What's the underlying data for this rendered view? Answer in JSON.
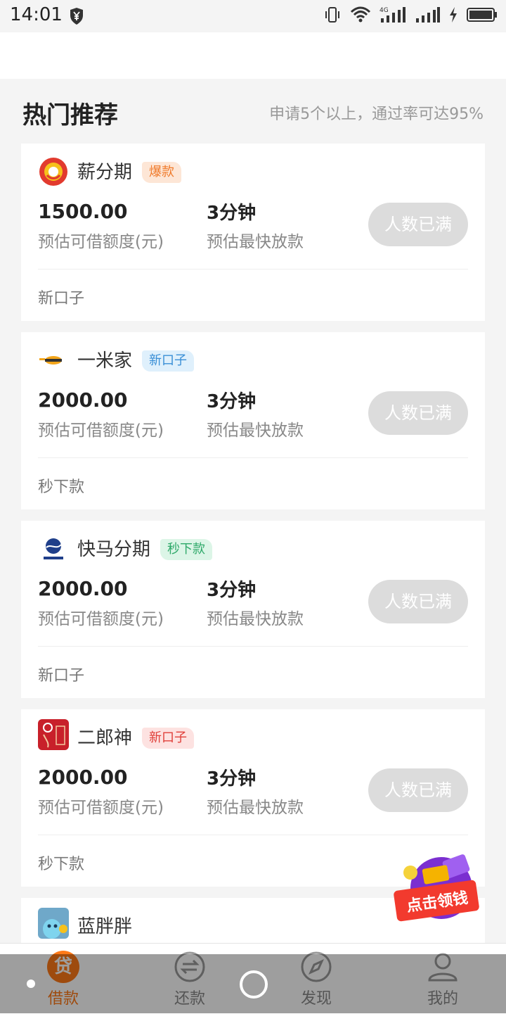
{
  "status_bar": {
    "time": "14:01"
  },
  "section": {
    "title": "热门推荐",
    "subtitle": "申请5个以上，通过率可达95%"
  },
  "products": [
    {
      "name": "薪分期",
      "tag": "爆款",
      "tag_color": "#f07a2a",
      "tag_bg": "#fde6d6",
      "amount": "1500.00",
      "amount_label": "预估可借额度(元)",
      "speed": "3分钟",
      "speed_label": "预估最快放款",
      "button": "人数已满",
      "note": "新口子"
    },
    {
      "name": "一米家",
      "tag": "新口子",
      "tag_color": "#3a8fd6",
      "tag_bg": "#dff0fc",
      "amount": "2000.00",
      "amount_label": "预估可借额度(元)",
      "speed": "3分钟",
      "speed_label": "预估最快放款",
      "button": "人数已满",
      "note": "秒下款"
    },
    {
      "name": "快马分期",
      "tag": "秒下款",
      "tag_color": "#2fa96a",
      "tag_bg": "#dcf5e7",
      "amount": "2000.00",
      "amount_label": "预估可借额度(元)",
      "speed": "3分钟",
      "speed_label": "预估最快放款",
      "button": "人数已满",
      "note": "新口子"
    },
    {
      "name": "二郎神",
      "tag": "新口子",
      "tag_color": "#e0403a",
      "tag_bg": "#fde2e1",
      "amount": "2000.00",
      "amount_label": "预估可借额度(元)",
      "speed": "3分钟",
      "speed_label": "预估最快放款",
      "button": "人数已满",
      "note": "秒下款"
    },
    {
      "name": "蓝胖胖"
    }
  ],
  "promo": {
    "label": "点击领钱"
  },
  "tabs": [
    {
      "label": "借款",
      "icon": "loan-icon",
      "active": true,
      "badge_char": "贷"
    },
    {
      "label": "还款",
      "icon": "repay-icon"
    },
    {
      "label": "发现",
      "icon": "compass-icon"
    },
    {
      "label": "我的",
      "icon": "profile-icon"
    }
  ],
  "colors": {
    "accent": "#ff7a18",
    "button_disabled": "#dcdcdc",
    "background": "#f4f4f4"
  }
}
